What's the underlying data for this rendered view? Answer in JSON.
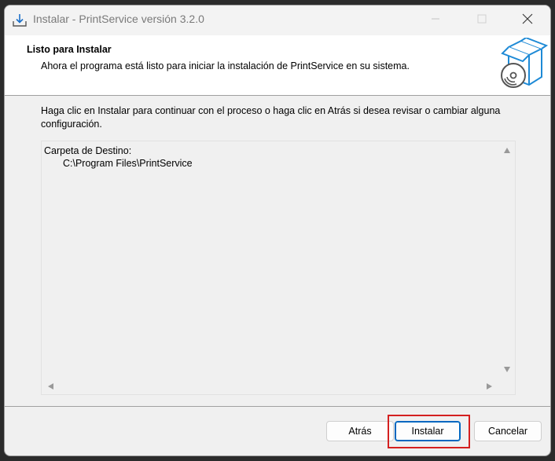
{
  "window": {
    "title": "Instalar - PrintService versión 3.2.0"
  },
  "header": {
    "title": "Listo para Instalar",
    "subtitle": "Ahora el programa está listo para iniciar la instalación de PrintService en su sistema."
  },
  "instruction": "Haga clic en Instalar para continuar con el proceso o haga clic en Atrás si desea revisar o cambiar alguna configuración.",
  "memo": {
    "line1": "Carpeta de Destino:",
    "line2": "C:\\Program Files\\PrintService"
  },
  "buttons": {
    "back": "Atrás",
    "install": "Instalar",
    "cancel": "Cancelar"
  },
  "icons": {
    "app": "download-arrow-icon",
    "header": "software-box-disc-icon"
  },
  "colors": {
    "accent": "#0067c0",
    "highlight": "#d42020"
  }
}
